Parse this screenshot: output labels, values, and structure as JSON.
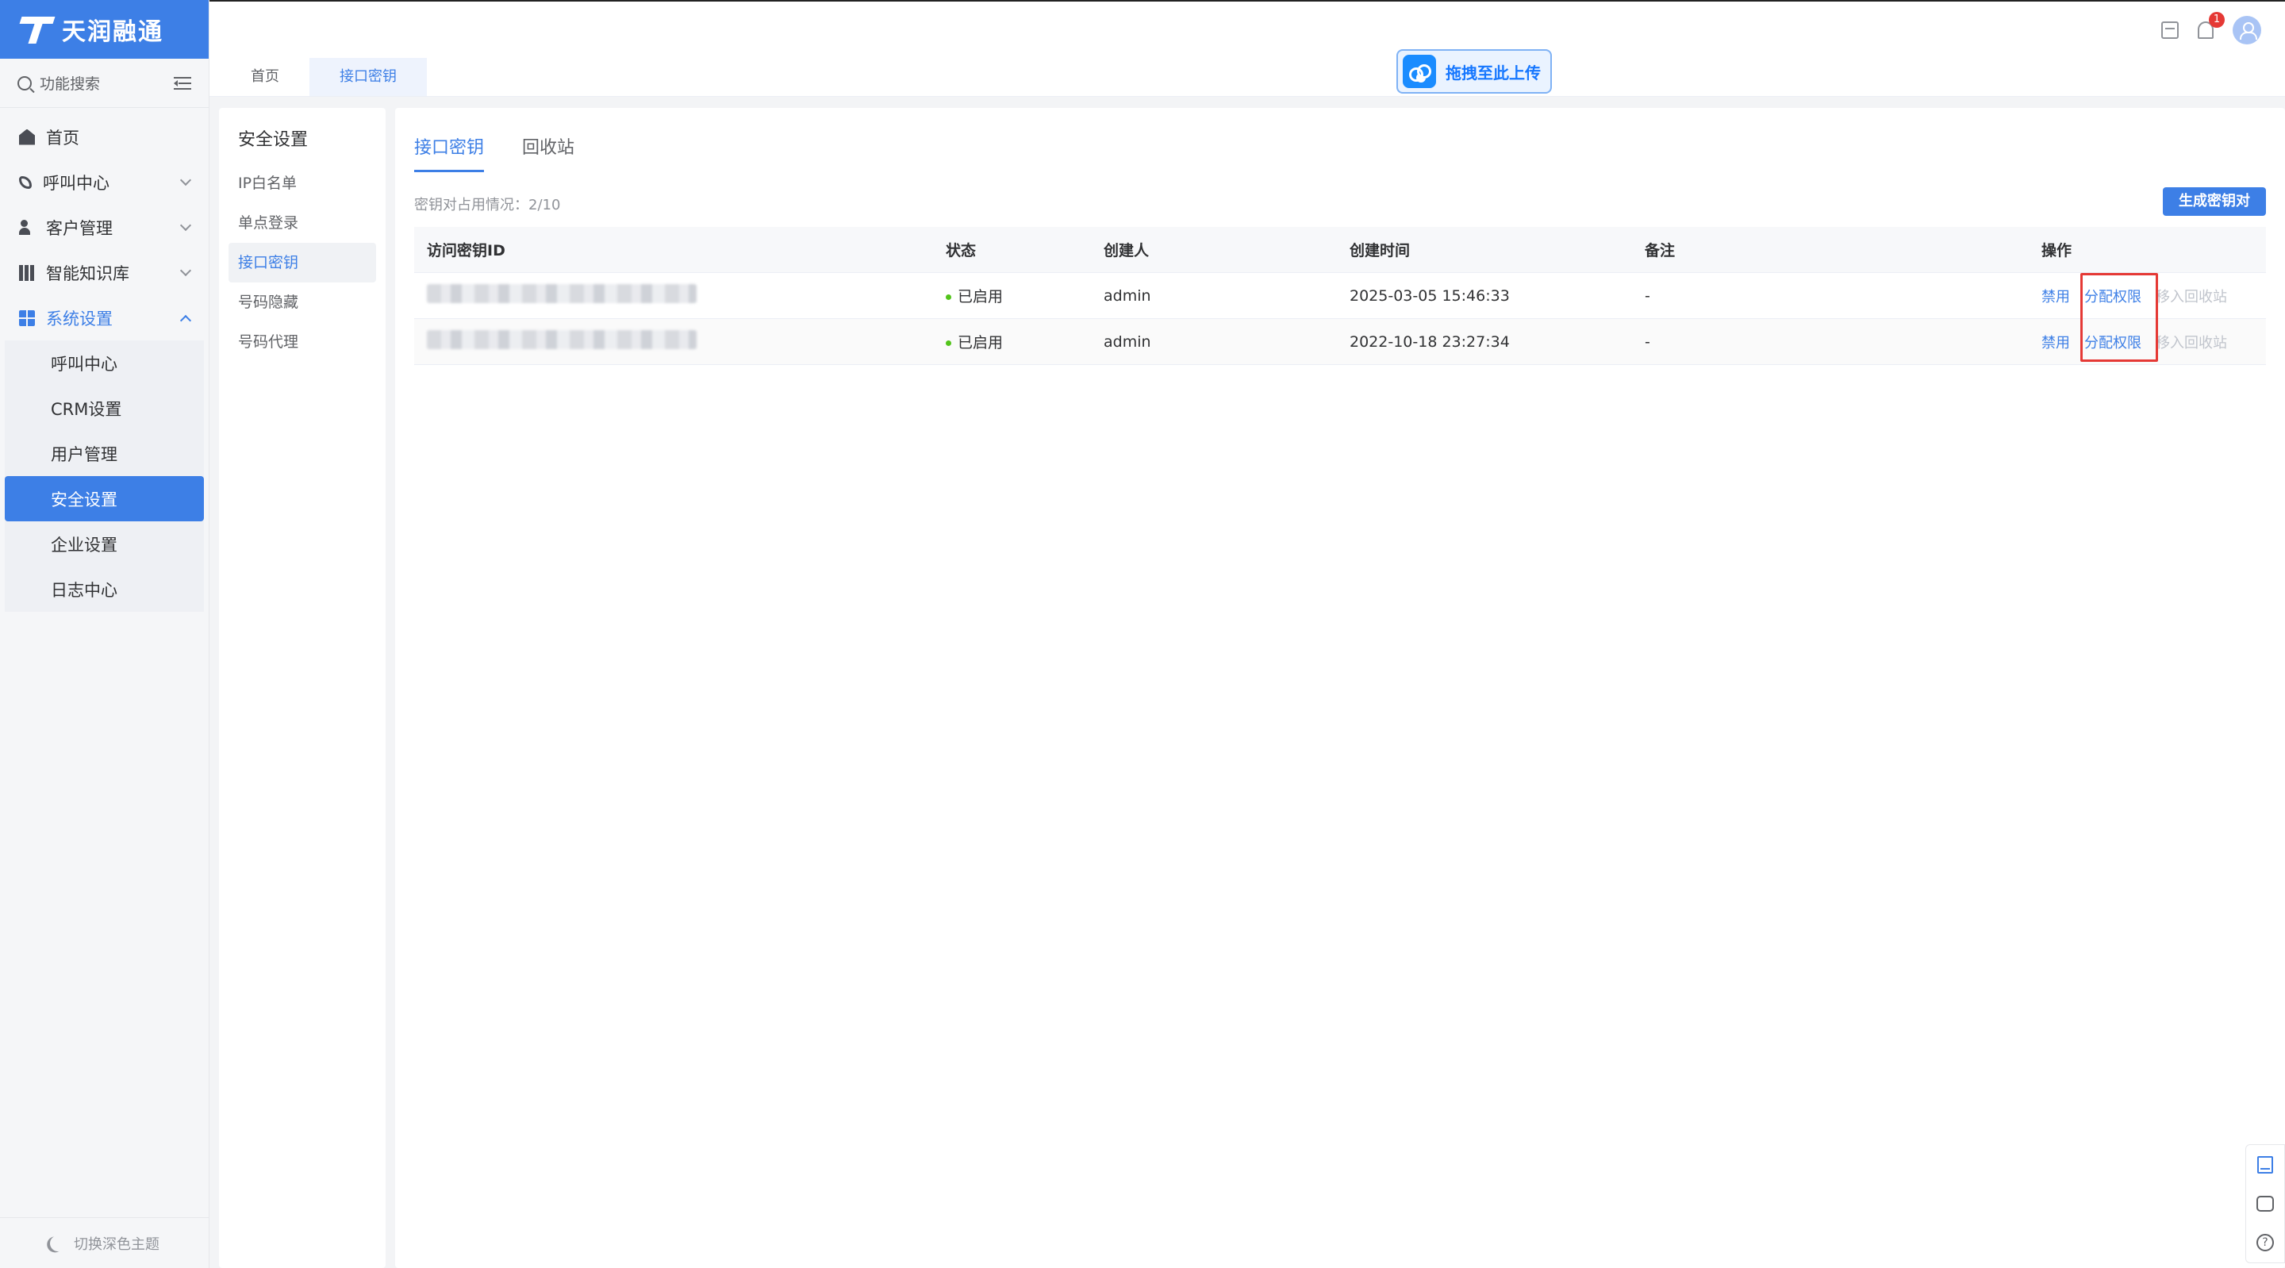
{
  "app": {
    "logo_text": "天润融通"
  },
  "search": {
    "placeholder": "功能搜索"
  },
  "sidebar": {
    "items": [
      {
        "label": "首页",
        "icon": "home-icon"
      },
      {
        "label": "呼叫中心",
        "icon": "phone-icon"
      },
      {
        "label": "客户管理",
        "icon": "users-icon"
      },
      {
        "label": "智能知识库",
        "icon": "grid-icon"
      },
      {
        "label": "系统设置",
        "icon": "apps-icon"
      }
    ],
    "sub_items": [
      "呼叫中心",
      "CRM设置",
      "用户管理",
      "安全设置",
      "企业设置",
      "日志中心"
    ],
    "theme_toggle": "切换深色主题"
  },
  "topbar": {
    "notification_count": "1"
  },
  "page_tabs": [
    "首页",
    "接口密钥"
  ],
  "upload": {
    "label": "拖拽至此上传"
  },
  "subnav": {
    "title": "安全设置",
    "items": [
      "IP白名单",
      "单点登录",
      "接口密钥",
      "号码隐藏",
      "号码代理"
    ]
  },
  "main": {
    "tabs": [
      "接口密钥",
      "回收站"
    ],
    "usage": "密钥对占用情况：2/10",
    "generate_button": "生成密钥对",
    "table": {
      "headers": [
        "访问密钥ID",
        "状态",
        "创建人",
        "创建时间",
        "备注",
        "操作"
      ],
      "rows": [
        {
          "status": "已启用",
          "creator": "admin",
          "created": "2025-03-05 15:46:33",
          "remark": "-"
        },
        {
          "status": "已启用",
          "creator": "admin",
          "created": "2022-10-18 23:27:34",
          "remark": "-"
        }
      ],
      "actions": {
        "disable": "禁用",
        "assign": "分配权限",
        "recycle": "移入回收站"
      }
    }
  },
  "colors": {
    "accent": "#3d7fe6",
    "status_ok": "#52c41a",
    "highlight": "#e53935"
  }
}
